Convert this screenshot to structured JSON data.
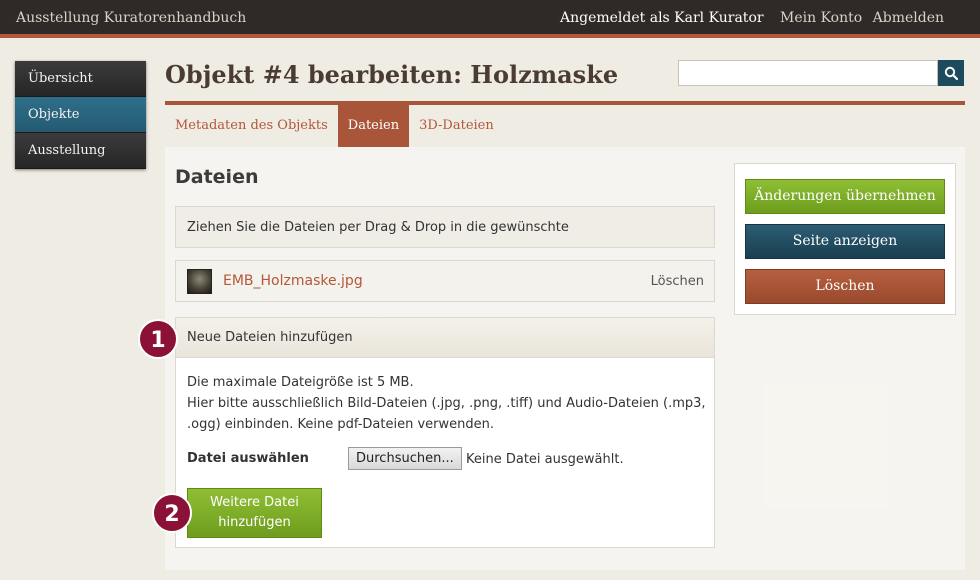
{
  "header": {
    "site_title": "Ausstellung Kuratorenhandbuch",
    "logged_in_as": "Angemeldet als Karl Kurator",
    "my_account": "Mein Konto",
    "logout": "Abmelden"
  },
  "sidebar": {
    "items": [
      {
        "label": "Übersicht"
      },
      {
        "label": "Objekte"
      },
      {
        "label": "Ausstellung"
      }
    ]
  },
  "page": {
    "title": "Objekt #4 bearbeiten: Holzmaske"
  },
  "search": {
    "placeholder": "",
    "icon": "search-icon"
  },
  "tabs": [
    {
      "label": "Metadaten des Objekts"
    },
    {
      "label": "Dateien"
    },
    {
      "label": "3D-Dateien"
    }
  ],
  "files_section": {
    "title": "Dateien",
    "info": "Ziehen Sie die Dateien per Drag & Drop in die gewünschte Darstellungsreihenfolge.",
    "file": {
      "name": "EMB_Holzmaske.jpg",
      "delete_label": "Löschen"
    }
  },
  "upload": {
    "header": "Neue Dateien hinzufügen",
    "info_line1": "Die maximale Dateigröße ist 5 MB.",
    "info_line2": "Hier bitte ausschließlich Bild-Dateien (.jpg, .png, .tiff) und Audio-Dateien (.mp3, .ogg) einbinden. Keine pdf-Dateien verwenden.",
    "file_label": "Datei auswählen",
    "browse_label": "Durchsuchen...",
    "no_file": "Keine Datei ausgewählt.",
    "add_more_line1": "Weitere Datei",
    "add_more_line2": "hinzufügen"
  },
  "badges": {
    "one": "1",
    "two": "2"
  },
  "actions": {
    "save": "Änderungen übernehmen",
    "view": "Seite anzeigen",
    "delete": "Löschen"
  },
  "colors": {
    "accent": "#a8553a",
    "topbar": "#2f2a27",
    "green": "#7aab25",
    "blue": "#1e4a5e",
    "badge": "#8b1136"
  }
}
